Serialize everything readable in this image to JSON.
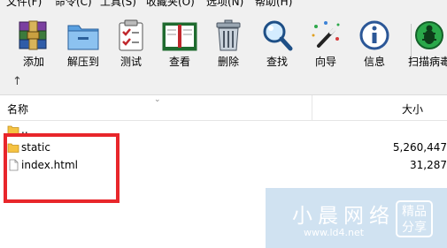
{
  "menubar": {
    "items": [
      "文件(F)",
      "命令(C)",
      "工具(S)",
      "收藏夹(O)",
      "选项(N)",
      "帮助(H)"
    ]
  },
  "toolbar": {
    "buttons": [
      {
        "label": "添加",
        "icon": "add-archive-icon"
      },
      {
        "label": "解压到",
        "icon": "extract-to-icon"
      },
      {
        "label": "测试",
        "icon": "test-icon"
      },
      {
        "label": "查看",
        "icon": "view-icon"
      },
      {
        "label": "删除",
        "icon": "delete-icon"
      },
      {
        "label": "查找",
        "icon": "find-icon"
      },
      {
        "label": "向导",
        "icon": "wizard-icon"
      },
      {
        "label": "信息",
        "icon": "info-icon"
      },
      {
        "label": "扫描病毒",
        "icon": "virus-scan-icon"
      }
    ]
  },
  "addressbar": {
    "up_icon": "↑"
  },
  "file_list": {
    "columns": {
      "name": "名称",
      "size": "大小"
    },
    "rows": [
      {
        "name": "..",
        "size": "",
        "type": "parent-folder"
      },
      {
        "name": "static",
        "size": "5,260,447",
        "type": "folder"
      },
      {
        "name": "index.html",
        "size": "31,287",
        "type": "file"
      }
    ]
  },
  "watermark": {
    "text": "小晨网络",
    "url": "www.ld4.net",
    "badge_line1": "精品",
    "badge_line2": "分享"
  },
  "colors": {
    "highlight": "#e8262b",
    "toolbar_bg": "#f0f0f0",
    "folder": "#f5c242"
  }
}
